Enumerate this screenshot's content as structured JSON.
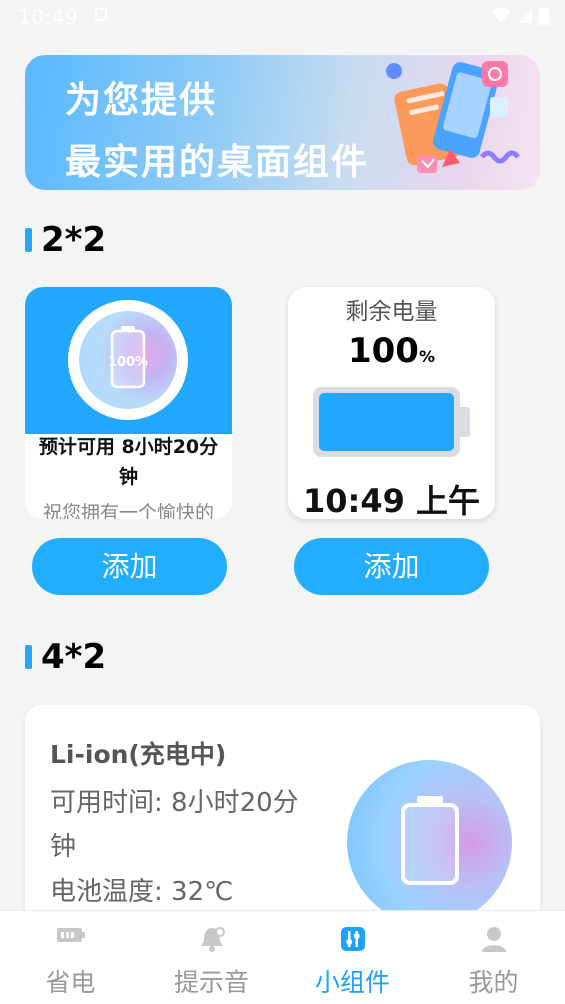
{
  "status_bar": {
    "time": "10:49"
  },
  "banner": {
    "line1": "为您提供",
    "line2": "最实用的桌面组件"
  },
  "section_2x2": {
    "title": "2*2"
  },
  "widget_estimate": {
    "icon_label": "100%",
    "estimate_line1": "预计可用 8小时20分",
    "estimate_line2": "钟",
    "wish": "祝您拥有一个愉快的"
  },
  "widget_battery": {
    "label": "剩余电量",
    "percent": "100",
    "percent_unit": "%",
    "level": 1.0,
    "time": "10:49 上午"
  },
  "add_buttons": [
    "添加",
    "添加"
  ],
  "section_4x2": {
    "title": "4*2"
  },
  "widget_detail": {
    "title": "Li-ion(充电中)",
    "available_line1": "可用时间: 8小时20分",
    "available_line2": "钟",
    "temperature": "电池温度: 32℃"
  },
  "bottom_nav": {
    "items": [
      {
        "label": "省电",
        "icon": "battery-icon",
        "active": false
      },
      {
        "label": "提示音",
        "icon": "bell-icon",
        "active": false
      },
      {
        "label": "小组件",
        "icon": "widgets-icon",
        "active": true
      },
      {
        "label": "我的",
        "icon": "profile-icon",
        "active": false
      }
    ]
  },
  "colors": {
    "accent": "#22a7ff",
    "background": "#f4f4f4",
    "inactive": "#999999"
  }
}
